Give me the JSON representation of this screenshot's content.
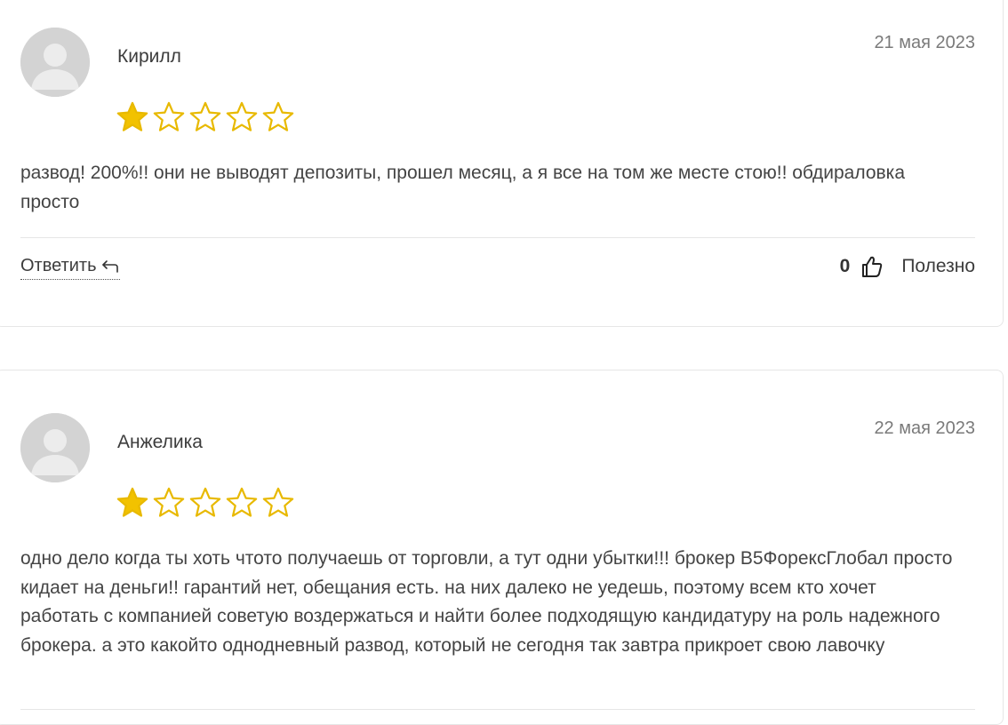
{
  "reviews": [
    {
      "author": "Кирилл",
      "date": "21 мая 2023",
      "rating": 1,
      "rating_max": 5,
      "text": "развод! 200%!! они не выводят депозиты, прошел месяц, а я все на том же месте стою!! обдираловка просто",
      "reply_label": "Ответить",
      "likes": "0",
      "useful_label": "Полезно"
    },
    {
      "author": "Анжелика",
      "date": "22 мая 2023",
      "rating": 1,
      "rating_max": 5,
      "text": "одно дело когда ты хоть чтото получаешь от торговли, а тут одни убытки!!! брокер B5ФорексГлобал просто кидает на деньги!! гарантий нет, обещания есть. на них далеко не уедешь, поэтому всем кто хочет работать с компанией советую воздержаться и найти более подходящую кандидатуру на роль надежного брокера. а это какойто однодневный развод, который не сегодня так завтра прикроет свою лавочку"
    }
  ],
  "colors": {
    "star_filled": "#F2C200",
    "star_outline": "#E8B900",
    "avatar_bg": "#D3D3D3",
    "divider": "#E6E6E6"
  },
  "icons": {
    "star": "star-icon",
    "reply": "reply-arrow-icon",
    "like": "thumbs-up-icon",
    "avatar": "user-avatar-icon"
  }
}
